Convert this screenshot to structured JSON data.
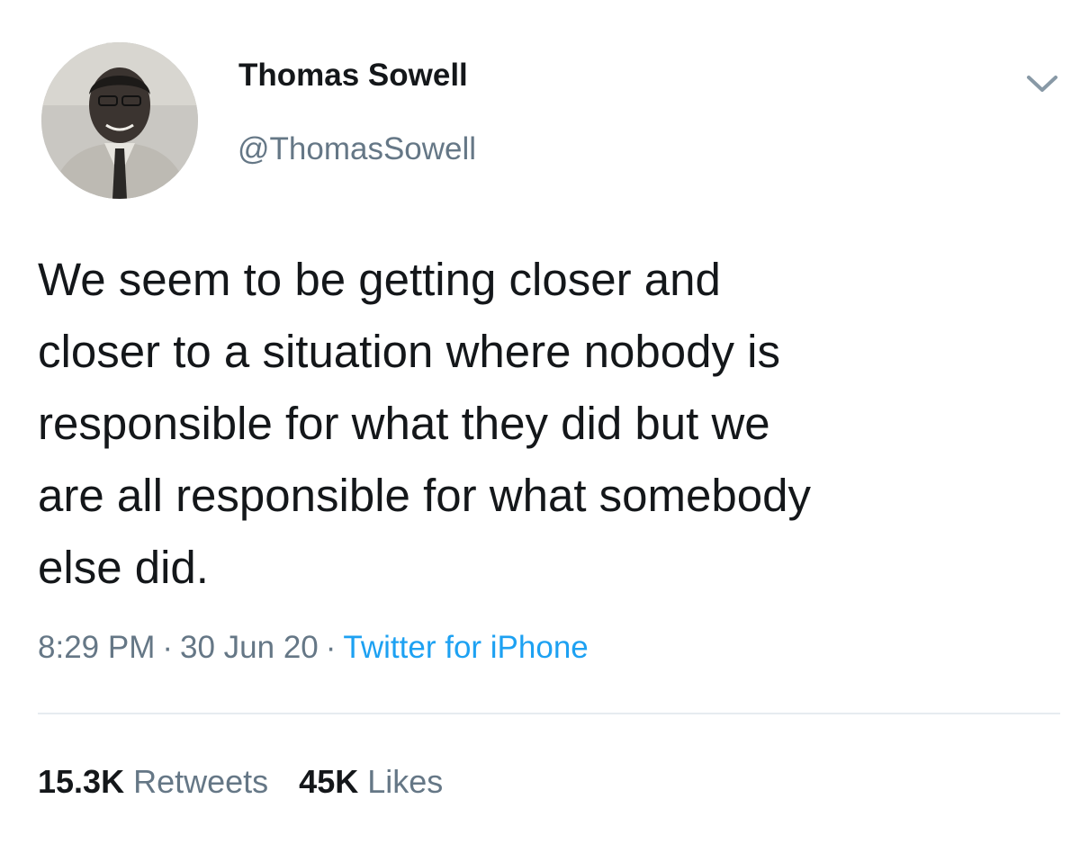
{
  "author": {
    "display_name": "Thomas Sowell",
    "handle": "@ThomasSowell",
    "avatar_icon": "profile-photo"
  },
  "header": {
    "menu_icon": "chevron-down-icon"
  },
  "tweet": {
    "text": "We seem to be getting closer and\ncloser to a situation where nobody is\nresponsible for what they did but we\nare all responsible for what somebody\nelse did."
  },
  "meta": {
    "time": "8:29 PM",
    "separator": "·",
    "date": "30 Jun 20",
    "source": "Twitter for iPhone"
  },
  "stats": {
    "retweets_count": "15.3K",
    "retweets_label": "Retweets",
    "likes_count": "45K",
    "likes_label": "Likes"
  },
  "colors": {
    "text": "#14171a",
    "secondary": "#657786",
    "link": "#1da1f2",
    "divider": "#e6ecf0"
  }
}
